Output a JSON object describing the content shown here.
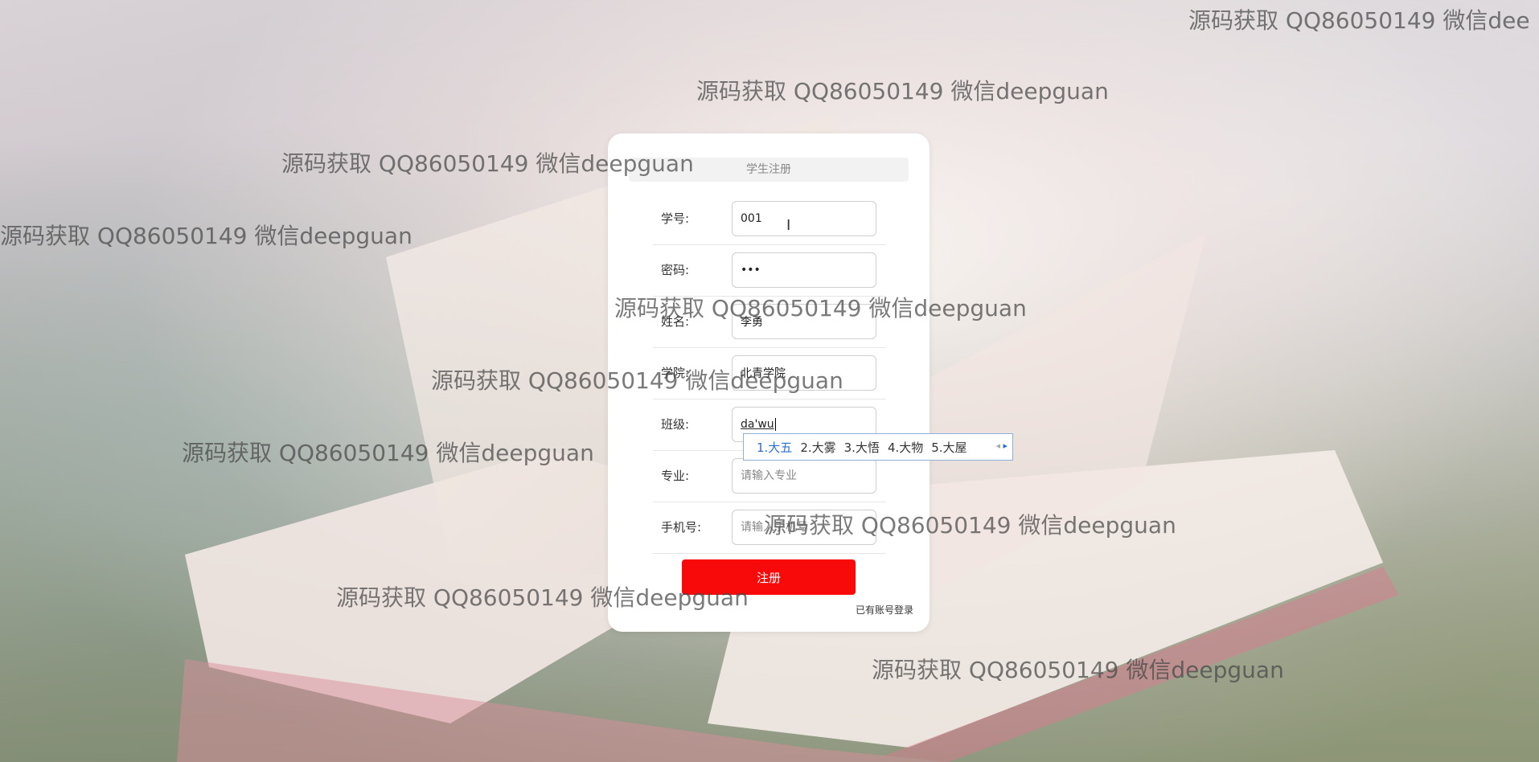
{
  "form": {
    "title": "学生注册",
    "fields": [
      {
        "label": "学号:",
        "value": "001",
        "placeholder": ""
      },
      {
        "label": "密码:",
        "value": "•••",
        "placeholder": ""
      },
      {
        "label": "姓名:",
        "value": "李勇",
        "placeholder": ""
      },
      {
        "label": "学院:",
        "value": "北青学院",
        "placeholder": ""
      },
      {
        "label": "班级:",
        "value": "da'wu",
        "placeholder": ""
      },
      {
        "label": "专业:",
        "value": "",
        "placeholder": "请输入专业"
      },
      {
        "label": "手机号:",
        "value": "",
        "placeholder": "请输入手机号"
      }
    ],
    "submit_label": "注册",
    "login_link": "已有账号登录"
  },
  "ime": {
    "candidates": [
      "1.大五",
      "2.大雾",
      "3.大悟",
      "4.大物",
      "5.大屋"
    ]
  },
  "watermark_text": "源码获取 QQ86050149 微信deepguan",
  "watermark_text_cut": "源码获取 QQ86050149 微信dee"
}
